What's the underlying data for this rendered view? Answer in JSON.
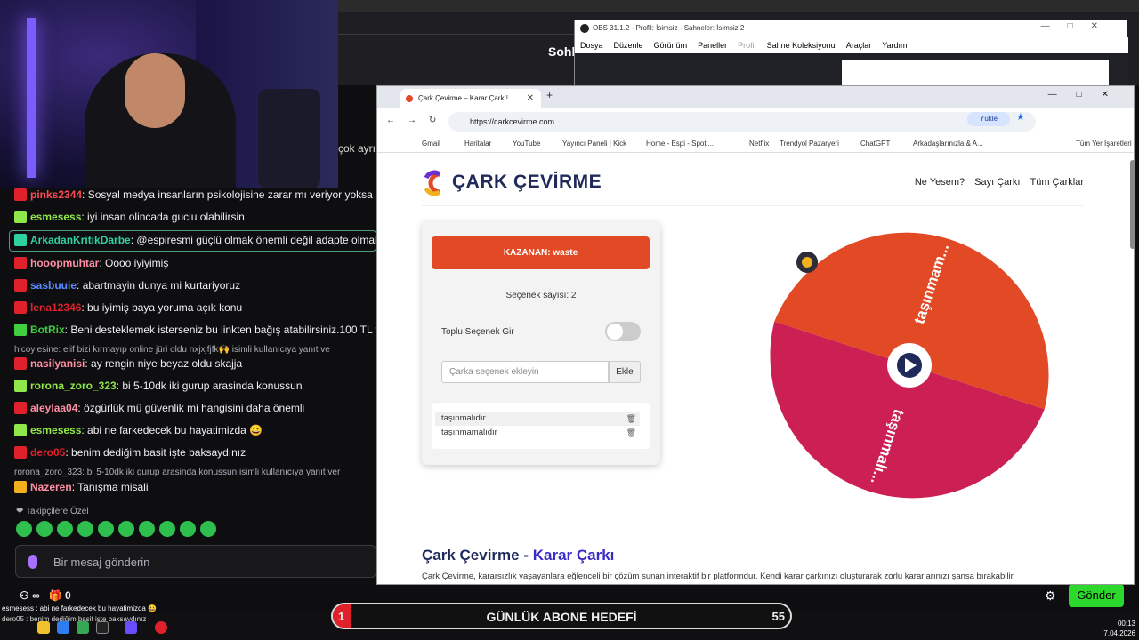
{
  "stream_header": {
    "title_fragment": "Sohl",
    "chat_fragment": "çok ayrış"
  },
  "chat": {
    "messages": [
      {
        "user": "pinks2344",
        "text": ": Sosyal medya insanların psikolojisine zarar mı veriyor yoksa fay",
        "color": "#ff4b55"
      },
      {
        "user": "esmesess",
        "text": ": iyi insan olincada guclu olabilirsin",
        "color": "#8fe84a"
      },
      {
        "user": "ArkadanKritikDarbe",
        "text": ": @espiresmi güçlü olmak önemli değil adapte olmak ön",
        "color": "#2fd1a0"
      },
      {
        "user": "hooopmuhtar",
        "text": ": Oooo iyiyimiş",
        "color": "#ff8fa4"
      },
      {
        "user": "sasbuuie",
        "text": ": abartmayin dunya mi kurtariyoruz",
        "color": "#5a8cff"
      },
      {
        "user": "lena12346",
        "text": ": bu iyimiş baya yoruma açık konu",
        "color": "#e0202a"
      },
      {
        "user": "BotRix",
        "text": ": Beni desteklemek isterseniz bu linkten bağış atabilirsiniz.100 TL v",
        "color": "#3fcf3f"
      },
      {
        "user": "nasilyanisi",
        "text": ": ay rengin niye beyaz oldu skajja",
        "color": "#ff8fa4"
      },
      {
        "user": "rorona_zoro_323",
        "text": ": bi 5-10dk iki gurup arasinda konussun",
        "color": "#8fe84a"
      },
      {
        "user": "aleylaa04",
        "text": ": özgürlük mü güvenlik mi hangisini daha önemli",
        "color": "#ff8fa4"
      },
      {
        "user": "esmesess",
        "text": ": abi ne farkedecek bu hayatimizda 😀",
        "color": "#8fe84a"
      },
      {
        "user": "dero05",
        "text": ": benim dediğim basit işte baksaydınız",
        "color": "#e0202a"
      },
      {
        "user": "Nazeren",
        "text": ": Tanışma misali",
        "color": "#ff8fa4"
      }
    ],
    "replies": [
      "hicoylesine: elif bizi kırmayıp online jüri oldu nxjxjfjfk🙌 isimli kullanıcıya yanıt ve",
      "rorona_zoro_323: bi 5-10dk iki gurup arasinda konussun isimli kullanıcıya yanıt ver"
    ],
    "followers_label": "Takipçilere Özel",
    "input_placeholder": "Bir mesaj gönderin",
    "stat_viewers": "∞",
    "stat_count": "0",
    "send_label": "Gönder"
  },
  "overlay": {
    "line1": "esmesess : abi ne farkedecek bu hayatimizda 😀",
    "line2": "dero05 : benim dediğim basit işte baksaydınız",
    "goal_title": "GÜNLÜK ABONE HEDEFİ",
    "goal_current": "1",
    "goal_target": "55",
    "goal_fraction": 0.018
  },
  "clock": {
    "time": "00:13",
    "date": "7.04.2026"
  },
  "obs": {
    "title": "OBS 31.1.2 - Profil: İsimsiz - Sahneler: İsimsiz 2",
    "menu": [
      "Dosya",
      "Düzenle",
      "Görünüm",
      "Paneller",
      "Profil",
      "Sahne Koleksiyonu",
      "Araçlar",
      "Yardım"
    ]
  },
  "browser": {
    "tab_title": "Çark Çevirme – Karar Çarkı!",
    "url": "https://carkcevirme.com",
    "upload_label": "Yükle",
    "bookmarks": [
      "Gmail",
      "Haritalar",
      "YouTube",
      "Yayıncı Paneli | Kick",
      "Home - Espi - Spoti...",
      "Netflix",
      "Trendyol Pazaryeri",
      "ChatGPT",
      "Arkadaşlarınızla & A...",
      "Tüm Yer İşaretleri"
    ]
  },
  "site": {
    "name": "ÇARK ÇEVİRME",
    "nav": [
      "Ne Yesem?",
      "Sayı Çarkı",
      "Tüm Çarklar"
    ],
    "winner": "KAZANAN: waste",
    "option_count": "Seçenek sayısı: 2",
    "bulk_label": "Toplu Seçenek Gir",
    "option_placeholder": "Çarka seçenek ekleyin",
    "add_label": "Ekle",
    "options": [
      "taşınmalıdır",
      "taşınmamalıdır"
    ],
    "wheel_labels": [
      "taşınmam...",
      "taşınmalı..."
    ],
    "wheel_colors": [
      "#e14a25",
      "#cc1f54"
    ],
    "heading_part1": "Çark Çevirme - ",
    "heading_part2": "Karar Çarkı",
    "paragraph": "Çark Çevirme, kararsızlık yaşayanlara eğlenceli bir çözüm sunan interaktif bir platformdur. Kendi karar çarkınızı oluşturarak zorlu kararlarınızı şansa bırakabilir"
  }
}
